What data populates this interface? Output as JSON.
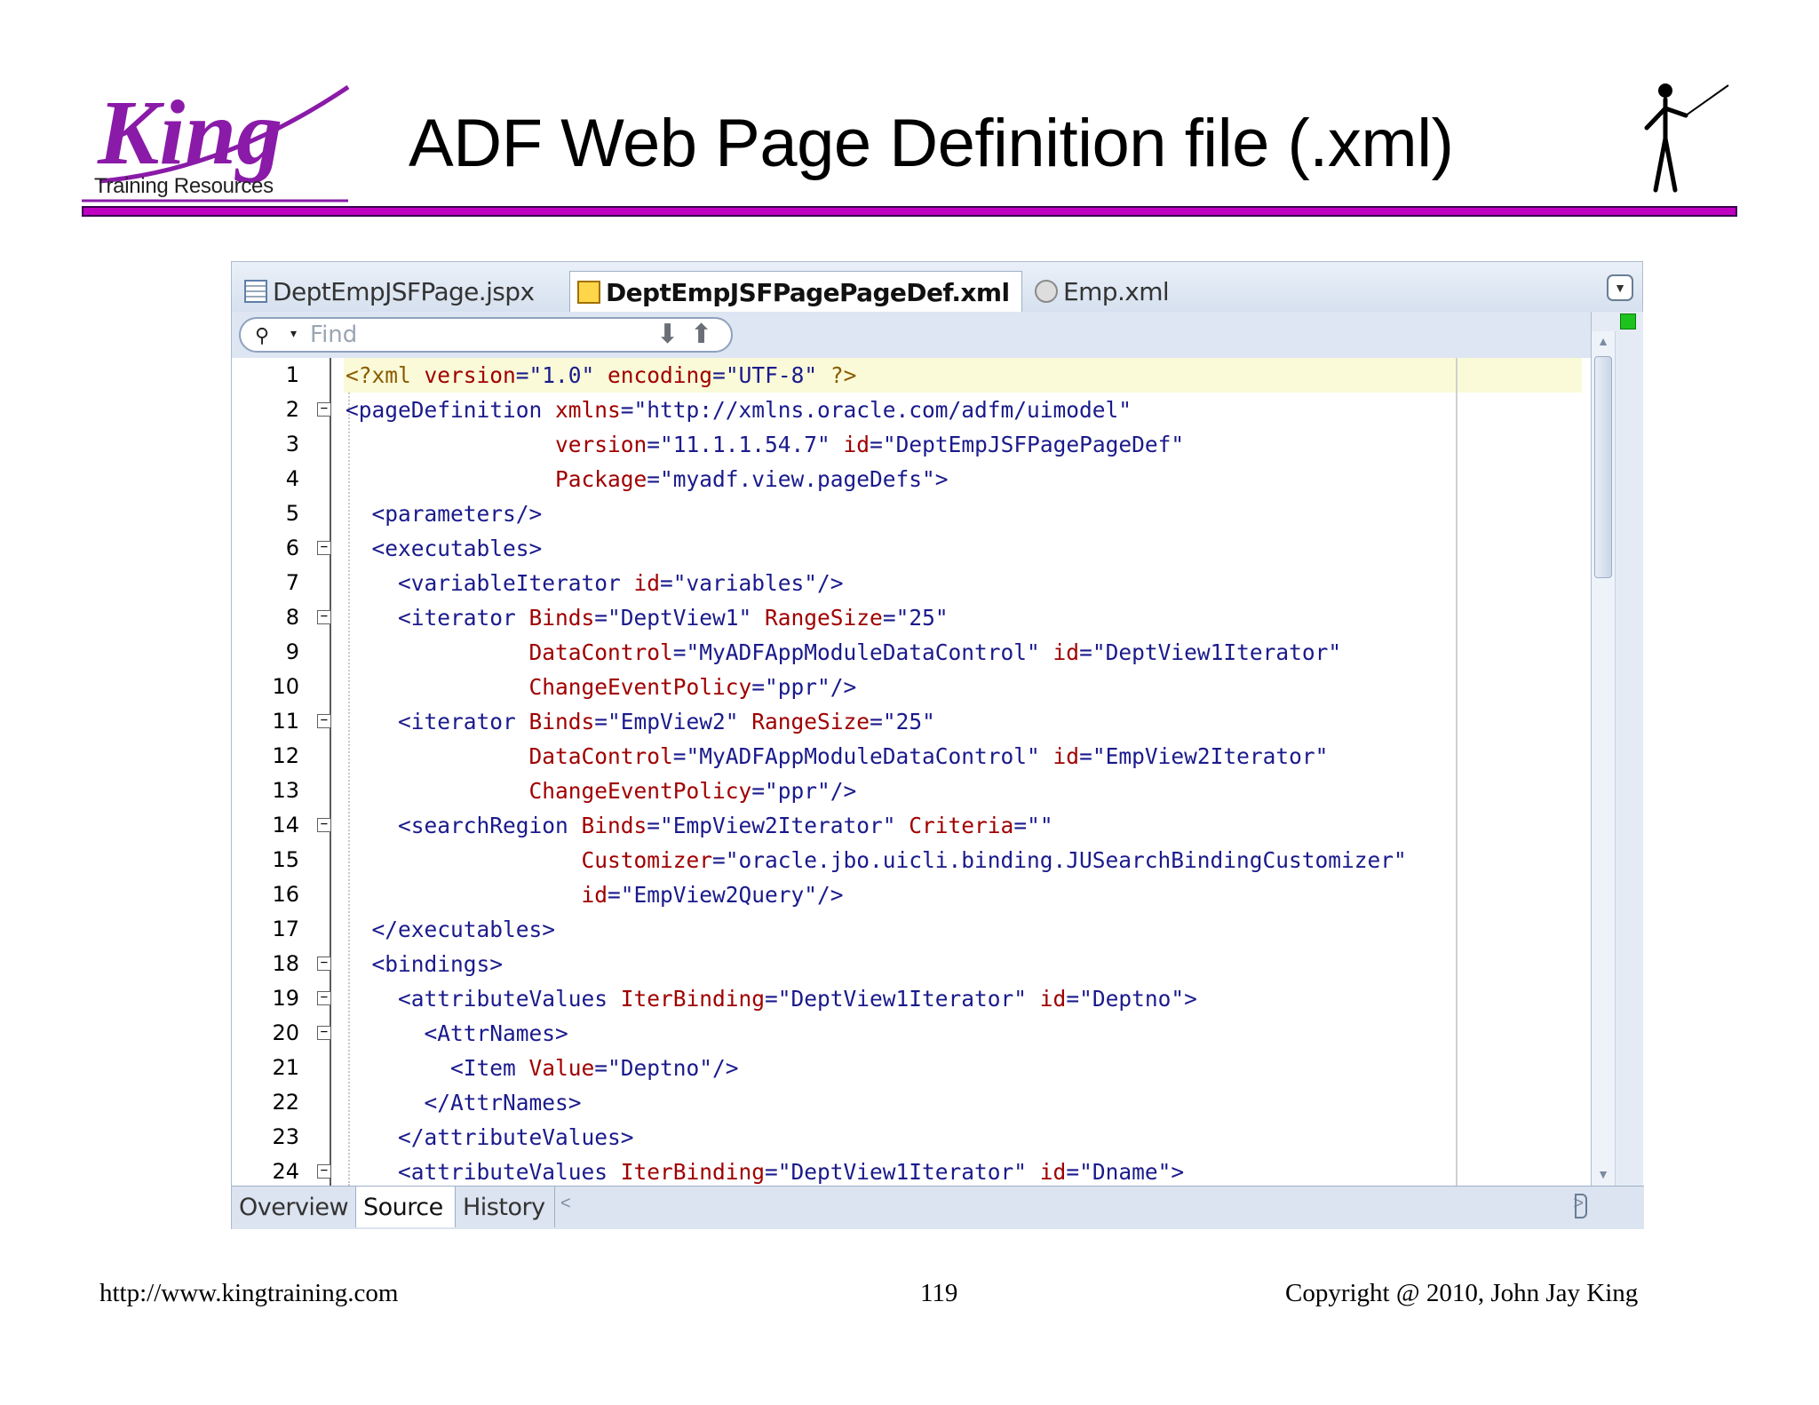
{
  "slide": {
    "logo_text": "King",
    "logo_subtext": "Training Resources",
    "title": "ADF Web Page Definition file (.xml)",
    "footer_url": "http://www.kingtraining.com",
    "page_number": "119",
    "copyright": "Copyright @ 2010, John Jay King"
  },
  "ide": {
    "tabs": [
      {
        "label": "DeptEmpJSFPage.jspx",
        "icon": "jspx-file-icon",
        "active": false
      },
      {
        "label": "DeptEmpJSFPagePageDef.xml",
        "icon": "xml-file-icon",
        "active": true
      },
      {
        "label": "Emp.xml",
        "icon": "entity-object-icon",
        "active": false
      }
    ],
    "find": {
      "placeholder": "Find",
      "value": ""
    },
    "bottom_tabs": [
      {
        "label": "Overview",
        "active": false
      },
      {
        "label": "Source",
        "active": true
      },
      {
        "label": "History",
        "active": false
      }
    ],
    "lines": [
      {
        "n": "1",
        "fold": false,
        "segments": [
          [
            "pi",
            "<?xml "
          ],
          [
            "attr",
            "version"
          ],
          [
            "tag",
            "=\"1.0\" "
          ],
          [
            "attr",
            "encoding"
          ],
          [
            "tag",
            "=\"UTF-8\" "
          ],
          [
            "pi",
            "?>"
          ]
        ]
      },
      {
        "n": "2",
        "fold": true,
        "segments": [
          [
            "tag",
            "<pageDefinition "
          ],
          [
            "attr",
            "xmlns"
          ],
          [
            "val",
            "=\"http://xmlns.oracle.com/adfm/uimodel\""
          ]
        ]
      },
      {
        "n": "3",
        "fold": false,
        "segments": [
          [
            "tag",
            "                "
          ],
          [
            "attr",
            "version"
          ],
          [
            "val",
            "=\"11.1.1.54.7\" "
          ],
          [
            "attr",
            "id"
          ],
          [
            "val",
            "=\"DeptEmpJSFPagePageDef\""
          ]
        ]
      },
      {
        "n": "4",
        "fold": false,
        "segments": [
          [
            "tag",
            "                "
          ],
          [
            "attr",
            "Package"
          ],
          [
            "val",
            "=\"myadf.view.pageDefs\">"
          ]
        ]
      },
      {
        "n": "5",
        "fold": false,
        "segments": [
          [
            "tag",
            "  <parameters/>"
          ]
        ]
      },
      {
        "n": "6",
        "fold": true,
        "segments": [
          [
            "tag",
            "  <executables>"
          ]
        ]
      },
      {
        "n": "7",
        "fold": false,
        "segments": [
          [
            "tag",
            "    <variableIterator "
          ],
          [
            "attr",
            "id"
          ],
          [
            "val",
            "=\"variables\"/>"
          ]
        ]
      },
      {
        "n": "8",
        "fold": true,
        "segments": [
          [
            "tag",
            "    <iterator "
          ],
          [
            "attr",
            "Binds"
          ],
          [
            "val",
            "=\"DeptView1\" "
          ],
          [
            "attr",
            "RangeSize"
          ],
          [
            "val",
            "=\"25\""
          ]
        ]
      },
      {
        "n": "9",
        "fold": false,
        "segments": [
          [
            "tag",
            "              "
          ],
          [
            "attr",
            "DataControl"
          ],
          [
            "val",
            "=\"MyADFAppModuleDataControl\" "
          ],
          [
            "attr",
            "id"
          ],
          [
            "val",
            "=\"DeptView1Iterator\""
          ]
        ]
      },
      {
        "n": "10",
        "fold": false,
        "segments": [
          [
            "tag",
            "              "
          ],
          [
            "attr",
            "ChangeEventPolicy"
          ],
          [
            "val",
            "=\"ppr\"/>"
          ]
        ]
      },
      {
        "n": "11",
        "fold": true,
        "segments": [
          [
            "tag",
            "    <iterator "
          ],
          [
            "attr",
            "Binds"
          ],
          [
            "val",
            "=\"EmpView2\" "
          ],
          [
            "attr",
            "RangeSize"
          ],
          [
            "val",
            "=\"25\""
          ]
        ]
      },
      {
        "n": "12",
        "fold": false,
        "segments": [
          [
            "tag",
            "              "
          ],
          [
            "attr",
            "DataControl"
          ],
          [
            "val",
            "=\"MyADFAppModuleDataControl\" "
          ],
          [
            "attr",
            "id"
          ],
          [
            "val",
            "=\"EmpView2Iterator\""
          ]
        ]
      },
      {
        "n": "13",
        "fold": false,
        "segments": [
          [
            "tag",
            "              "
          ],
          [
            "attr",
            "ChangeEventPolicy"
          ],
          [
            "val",
            "=\"ppr\"/>"
          ]
        ]
      },
      {
        "n": "14",
        "fold": true,
        "segments": [
          [
            "tag",
            "    <searchRegion "
          ],
          [
            "attr",
            "Binds"
          ],
          [
            "val",
            "=\"EmpView2Iterator\" "
          ],
          [
            "attr",
            "Criteria"
          ],
          [
            "val",
            "=\"\""
          ]
        ]
      },
      {
        "n": "15",
        "fold": false,
        "segments": [
          [
            "tag",
            "                  "
          ],
          [
            "attr",
            "Customizer"
          ],
          [
            "val",
            "=\"oracle.jbo.uicli.binding.JUSearchBindingCustomizer\""
          ]
        ]
      },
      {
        "n": "16",
        "fold": false,
        "segments": [
          [
            "tag",
            "                  "
          ],
          [
            "attr",
            "id"
          ],
          [
            "val",
            "=\"EmpView2Query\"/>"
          ]
        ]
      },
      {
        "n": "17",
        "fold": false,
        "segments": [
          [
            "tag",
            "  </executables>"
          ]
        ]
      },
      {
        "n": "18",
        "fold": true,
        "segments": [
          [
            "tag",
            "  <bindings>"
          ]
        ]
      },
      {
        "n": "19",
        "fold": true,
        "segments": [
          [
            "tag",
            "    <attributeValues "
          ],
          [
            "attr",
            "IterBinding"
          ],
          [
            "val",
            "=\"DeptView1Iterator\" "
          ],
          [
            "attr",
            "id"
          ],
          [
            "val",
            "=\"Deptno\">"
          ]
        ]
      },
      {
        "n": "20",
        "fold": true,
        "segments": [
          [
            "tag",
            "      <AttrNames>"
          ]
        ]
      },
      {
        "n": "21",
        "fold": false,
        "segments": [
          [
            "tag",
            "        <Item "
          ],
          [
            "attr",
            "Value"
          ],
          [
            "val",
            "=\"Deptno\"/>"
          ]
        ]
      },
      {
        "n": "22",
        "fold": false,
        "segments": [
          [
            "tag",
            "      </AttrNames>"
          ]
        ]
      },
      {
        "n": "23",
        "fold": false,
        "segments": [
          [
            "tag",
            "    </attributeValues>"
          ]
        ]
      },
      {
        "n": "24",
        "fold": true,
        "segments": [
          [
            "tag",
            "    <attributeValues "
          ],
          [
            "attr",
            "IterBinding"
          ],
          [
            "val",
            "=\"DeptView1Iterator\" "
          ],
          [
            "attr",
            "id"
          ],
          [
            "val",
            "=\"Dname\">"
          ]
        ]
      }
    ]
  },
  "colors": {
    "title_rule": "#c000c0",
    "logo": "#8a1aa8",
    "xml_tag": "#1a1a8c",
    "xml_attr": "#a00000",
    "current_line": "#fafad8",
    "status_ok": "#1ec21e"
  }
}
